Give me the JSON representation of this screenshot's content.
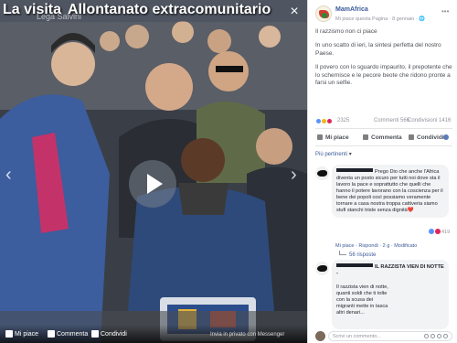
{
  "photo": {
    "headline_main": "La visita",
    "headline_sub": "Allontanato extracomunitario",
    "page_overlay": "Lega Salvini",
    "close_symbol": "×",
    "prev_symbol": "‹",
    "next_symbol": "›",
    "bottom_bar": {
      "like": "Mi piace",
      "comment": "Commenta",
      "share": "Condividi",
      "send": "Invia in privato con Messenger"
    }
  },
  "post": {
    "page_name": "MamAfrica",
    "meta": "Mi piace questa Pagina · 8 gennaio · 🌐",
    "more": "•••",
    "paragraphs": [
      "Il razzismo non ci piace",
      "In uno scatto di ieri, la sintesi perfetta del nostro Paese.",
      "Il povero con lo sguardo impaurito, il prepotente che lo schernisce e le pecore beote che ridono pronte a farsi un selfie."
    ],
    "reaction_count": "2325",
    "comments_count": "Commenti 566",
    "shares_count": "Condivisioni 1416",
    "actions": {
      "like": "Mi piace",
      "comment": "Commenta",
      "share": "Condividi"
    },
    "filter_label": "Più pertinenti",
    "filter_caret": "▾"
  },
  "comments": [
    {
      "text": "Prego Dio che anche l'Africa diventa un posto sicuro per tutti noi dove sta il lavoro la pace e soprattutto che quelli che hanno il potere lavorano con la coscienza per il bene dei popoli così possiamo veramente tornare a casa nostra troppa cattiveria siamo stufi stanchi triste senza dignità❤️",
      "actions": "Mi piace · Rispondi · 2 g · Modificato",
      "reactions": "419",
      "replies": "56 risposte"
    },
    {
      "title": "IL RAZZISTA VIEN DI NOTTE -",
      "text": "Il razzista vien di notte, quanti soldi che ti tolte con la scusa dei migranti mette in tasca altri denari..."
    },
    {}
  ],
  "write_comment": {
    "placeholder": "Scrivi un commento..."
  },
  "colors": {
    "link_blue": "#3b5998",
    "panel_bg": "#ffffff",
    "photo_bg": "#2b2e33"
  }
}
